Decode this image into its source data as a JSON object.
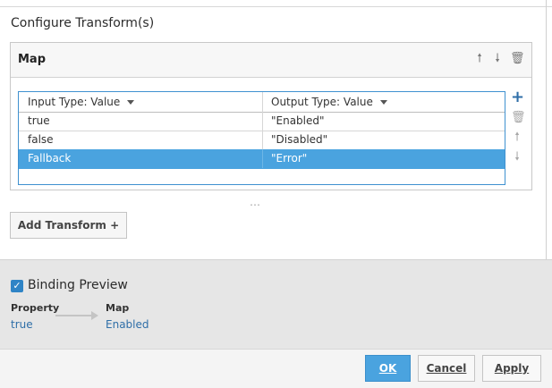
{
  "section_title": "Configure Transform(s)",
  "map": {
    "title": "Map",
    "header_icons": [
      "arrow-up-icon",
      "arrow-down-icon",
      "trash-icon"
    ],
    "columns": [
      "Input Type: Value",
      "Output Type: Value"
    ],
    "rows": [
      {
        "input": "true",
        "output": "\"Enabled\""
      },
      {
        "input": "false",
        "output": "\"Disabled\""
      },
      {
        "input": "Fallback",
        "output": "\"Error\"",
        "selected": true
      }
    ],
    "side_icons": [
      "plus-icon",
      "trash-icon",
      "arrow-up-icon",
      "arrow-down-icon"
    ]
  },
  "drag_handle": "⋯",
  "add_transform_label": "Add Transform +",
  "binding_preview": {
    "checkbox_checked": true,
    "title": "Binding Preview",
    "property_label": "Property",
    "property_value": "true",
    "map_label": "Map",
    "map_value": "Enabled"
  },
  "footer": {
    "ok_label": "OK",
    "cancel_label": "Cancel",
    "apply_label": "Apply"
  },
  "colors": {
    "accent": "#4aa3df",
    "link": "#2f6fa8",
    "preview_bg": "#e6e6e6"
  }
}
